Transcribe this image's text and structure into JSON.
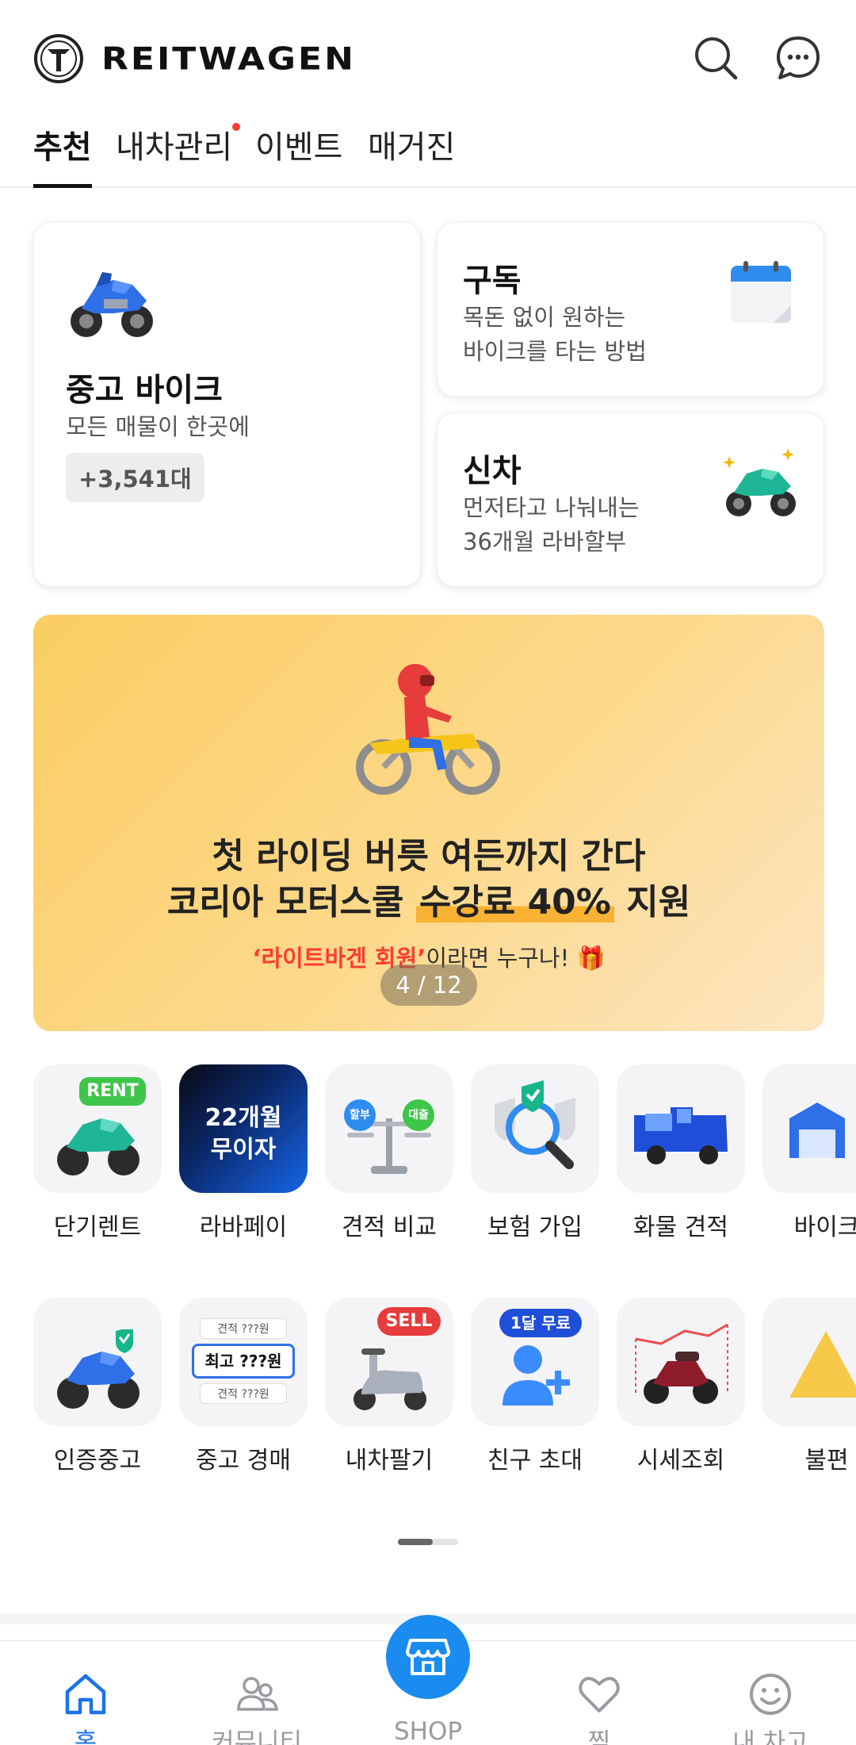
{
  "header": {
    "brand": "REITWAGEN",
    "icons": [
      "search-icon",
      "chat-icon"
    ]
  },
  "tabs": [
    {
      "label": "추천",
      "active": true
    },
    {
      "label": "내차관리",
      "dot": true
    },
    {
      "label": "이벤트"
    },
    {
      "label": "매거진"
    }
  ],
  "cards": {
    "used": {
      "title": "중고 바이크",
      "sub": "모든 매물이 한곳에",
      "count": "+3,541대"
    },
    "subscribe": {
      "title": "구독",
      "sub1": "목돈 없이 원하는",
      "sub2": "바이크를 타는 방법"
    },
    "new": {
      "title": "신차",
      "sub1": "먼저타고 나눠내는",
      "sub2": "36개월 라바할부"
    }
  },
  "banner": {
    "line1": "첫 라이딩 버릇 여든까지 간다",
    "line2_pre": "코리아 모터스쿨 ",
    "line2_hl": "수강료 40%",
    "line2_post": " 지원",
    "sub_red": "‘라이트바겐 회원’",
    "sub_rest": "이라면 누구나! 🎁",
    "pager": "4 / 12"
  },
  "menu_row1": [
    {
      "label": "단기렌트",
      "badge": "RENT"
    },
    {
      "label": "라바페이",
      "tile_text1": "22개월",
      "tile_text2": "무이자"
    },
    {
      "label": "견적 비교",
      "chip1": "할부",
      "chip2": "대출"
    },
    {
      "label": "보험 가입"
    },
    {
      "label": "화물 견적"
    },
    {
      "label": "바이크"
    }
  ],
  "menu_row2": [
    {
      "label": "인증중고"
    },
    {
      "label": "중고 경매",
      "small1": "견적   ???원",
      "big": "최고  ???원",
      "small2": "견적   ???원"
    },
    {
      "label": "내차팔기",
      "badge": "SELL"
    },
    {
      "label": "친구 초대",
      "badge": "1달 무료"
    },
    {
      "label": "시세조회"
    },
    {
      "label": "불편"
    }
  ],
  "bottom_nav": [
    {
      "label": "홈",
      "icon": "home-icon",
      "active": true
    },
    {
      "label": "커뮤니티",
      "icon": "community-icon"
    },
    {
      "label": "SHOP",
      "icon": "shop-icon"
    },
    {
      "label": "찜",
      "icon": "heart-icon"
    },
    {
      "label": "내 차고",
      "icon": "smile-icon"
    }
  ],
  "colors": {
    "accent": "#1a8cf0",
    "active_nav": "#1a73e8",
    "banner": "#fbcd62",
    "dot": "#ff3b30"
  }
}
